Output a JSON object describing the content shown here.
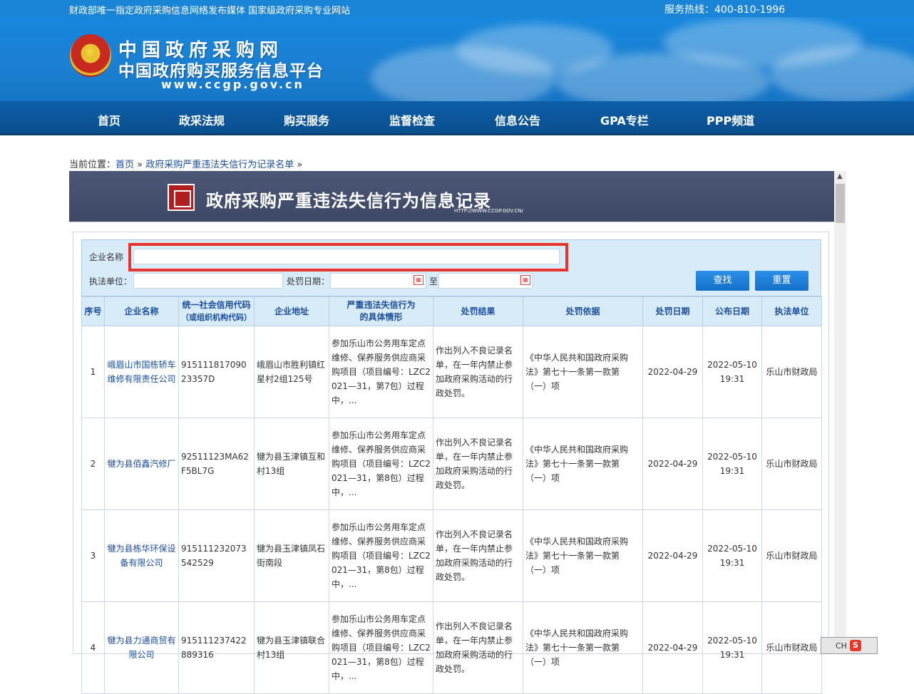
{
  "header": {
    "tagline": "财政部唯一指定政府采购信息网络发布媒体 国家级政府采购专业网站",
    "hotline": "服务热线：400-810-1996",
    "logo_line1": "中国政府采购网",
    "logo_line2": "中国政府购买服务信息平台",
    "logo_url": "www.ccgp.gov.cn"
  },
  "nav": [
    "首页",
    "政采法规",
    "购买服务",
    "监督检查",
    "信息公告",
    "GPA专栏",
    "PPP频道"
  ],
  "breadcrumb": {
    "prefix": "当前位置：",
    "home": "首页",
    "sep": " » ",
    "current": "政府采购严重违法失信行为记录名单",
    "tail": " »"
  },
  "title_banner": {
    "title": "政府采购严重违法失信行为信息记录",
    "url": "HTTP://WWW.CCGP.GOV.CN/"
  },
  "search": {
    "company_label": "企业名称",
    "company_value": "",
    "agency_label": "执法单位：",
    "agency_value": "",
    "date_label": "处罚日期：",
    "date_to": "至",
    "search_button": "查找",
    "reset_button": "重置"
  },
  "table": {
    "headers": [
      "序号",
      "企业名称",
      "统一社会信用代码",
      "（或组织机构代码）",
      "企业地址",
      "严重违法失信行为",
      "的具体情形",
      "处罚结果",
      "处罚依据",
      "处罚日期",
      "公布日期",
      "执法单位"
    ],
    "rows": [
      {
        "no": "1",
        "name": "峨眉山市国栋轿车维修有限责任公司",
        "code": "91511181709023357D",
        "address": "峨眉山市胜利镇红星村2组125号",
        "behavior": "参加乐山市公务用车定点维修、保养服务供应商采购项目（项目编号：LZC2021—31，第7包）过程中，...",
        "result": "作出列入不良记录名单，在一年内禁止参加政府采购活动的行政处罚。",
        "basis": "《中华人民共和国政府采购法》第七十一条第一款第（一）项",
        "penalty_date": "2022-04-29",
        "publish_date": "2022-05-10 19:31",
        "agency": "乐山市财政局"
      },
      {
        "no": "2",
        "name": "犍为县佰鑫汽修厂",
        "code": "92511123MA62F5BL7G",
        "address": "犍为县玉津镇互和村13组",
        "behavior": "参加乐山市公务用车定点维修、保养服务供应商采购项目（项目编号：LZC2021—31，第8包）过程中，...",
        "result": "作出列入不良记录名单，在一年内禁止参加政府采购活动的行政处罚。",
        "basis": "《中华人民共和国政府采购法》第七十一条第一款第（一）项",
        "penalty_date": "2022-04-29",
        "publish_date": "2022-05-10 19:31",
        "agency": "乐山市财政局"
      },
      {
        "no": "3",
        "name": "犍为县栋华环保设备有限公司",
        "code": "915111232073542529",
        "address": "犍为县玉津镇凤石街南段",
        "behavior": "参加乐山市公务用车定点维修、保养服务供应商采购项目（项目编号：LZC2021—31，第8包）过程中，...",
        "result": "作出列入不良记录名单，在一年内禁止参加政府采购活动的行政处罚。",
        "basis": "《中华人民共和国政府采购法》第七十一条第一款第（一）项",
        "penalty_date": "2022-04-29",
        "publish_date": "2022-05-10 19:31",
        "agency": "乐山市财政局"
      },
      {
        "no": "4",
        "name": "犍为县力通商贸有限公司",
        "code": "915111237422889316",
        "address": "犍为县玉津镇联合村13组",
        "behavior": "参加乐山市公务用车定点维修、保养服务供应商采购项目（项目编号：LZC2021—31，第8包）过程中，...",
        "result": "作出列入不良记录名单，在一年内禁止参加政府采购活动的行政处罚。",
        "basis": "《中华人民共和国政府采购法》第七十一条第一款第（一）项",
        "penalty_date": "2022-04-29",
        "publish_date": "2022-05-10 19:31",
        "agency": "乐山市财政局"
      }
    ]
  },
  "taskbar": {
    "lang": "CH",
    "ime": "S"
  }
}
